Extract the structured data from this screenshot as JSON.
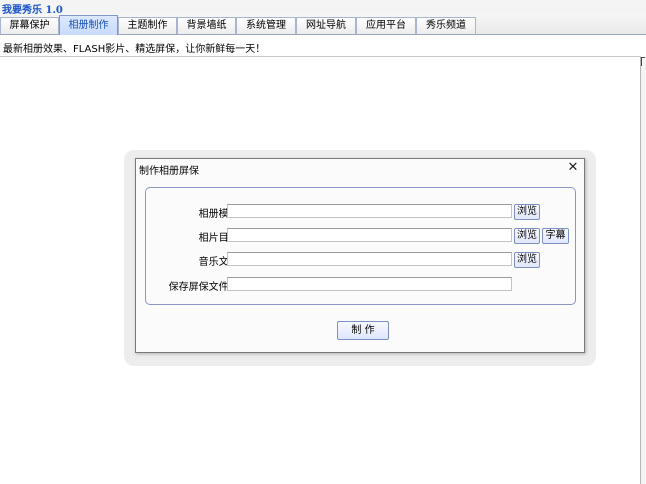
{
  "app": {
    "title": "我要秀乐 1.0"
  },
  "tabs": [
    {
      "label": "屏幕保护",
      "active": false
    },
    {
      "label": "相册制作",
      "active": true
    },
    {
      "label": "主题制作",
      "active": false
    },
    {
      "label": "背景墙纸",
      "active": false
    },
    {
      "label": "系统管理",
      "active": false
    },
    {
      "label": "网址导航",
      "active": false
    },
    {
      "label": "应用平台",
      "active": false
    },
    {
      "label": "秀乐频道",
      "active": false
    }
  ],
  "info": {
    "text": "最新相册效果、FLASH影片、精选屏保，让你新鲜每一天！"
  },
  "dialog": {
    "title": "制作相册屏保",
    "close_glyph": "✕",
    "fields": {
      "template": {
        "label": "相册模板:",
        "value": "",
        "browse_label": "浏览"
      },
      "photo_dir": {
        "label": "相片目录:",
        "value": "",
        "browse_label": "浏览",
        "subtitle_label": "字幕"
      },
      "music": {
        "label": "音乐文件:",
        "value": "",
        "browse_label": "浏览"
      },
      "save_name": {
        "label": "保存屏保文件名:",
        "value": ""
      }
    },
    "make_label": "制 作"
  },
  "colors": {
    "title_text": "#1a54c8",
    "active_tab_text": "#1a4fb8",
    "group_border": "#8e95c6",
    "button_border": "#7e91c4"
  },
  "icons": {
    "close": "close-icon"
  }
}
